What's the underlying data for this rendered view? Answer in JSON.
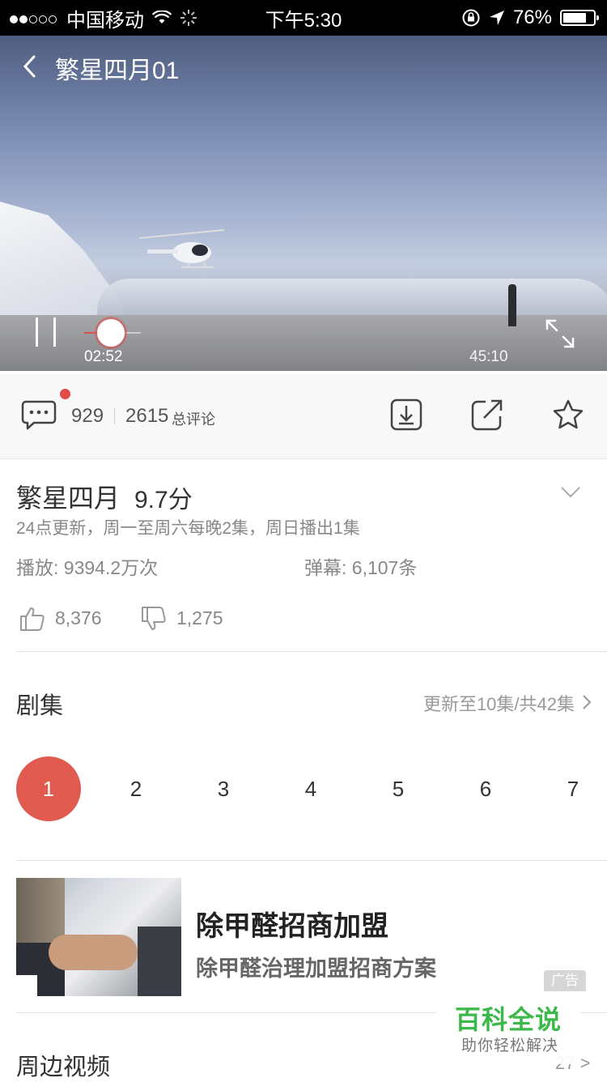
{
  "status_bar": {
    "carrier": "中国移动",
    "time": "下午5:30",
    "battery": "76%"
  },
  "player": {
    "title": "繁星四月01",
    "current_time": "02:52",
    "duration": "45:10",
    "progress": 0.063
  },
  "actions": {
    "comment_count": "929",
    "total_comments": "2615",
    "total_comments_label": "总评论"
  },
  "show": {
    "title": "繁星四月",
    "score": "9.7分",
    "schedule": "24点更新，周一至周六每晚2集，周日播出1集",
    "plays": "播放: 9394.2万次",
    "danmu": "弹幕: 6,107条",
    "likes": "8,376",
    "dislikes": "1,275"
  },
  "episodes": {
    "heading": "剧集",
    "update_info": "更新至10集/共42集",
    "items": [
      "1",
      "2",
      "3",
      "4",
      "5",
      "6",
      "7"
    ],
    "selected": "1"
  },
  "ad": {
    "title": "除甲醛招商加盟",
    "description": "除甲醛治理加盟招商方案",
    "tag": "广告"
  },
  "related": {
    "heading": "周边视频",
    "more": "27 >"
  },
  "watermark": {
    "main": "百科全说",
    "sub": "助你轻松解决"
  },
  "colors": {
    "accent": "#e05a50",
    "watermark_green": "#3cb94a"
  }
}
